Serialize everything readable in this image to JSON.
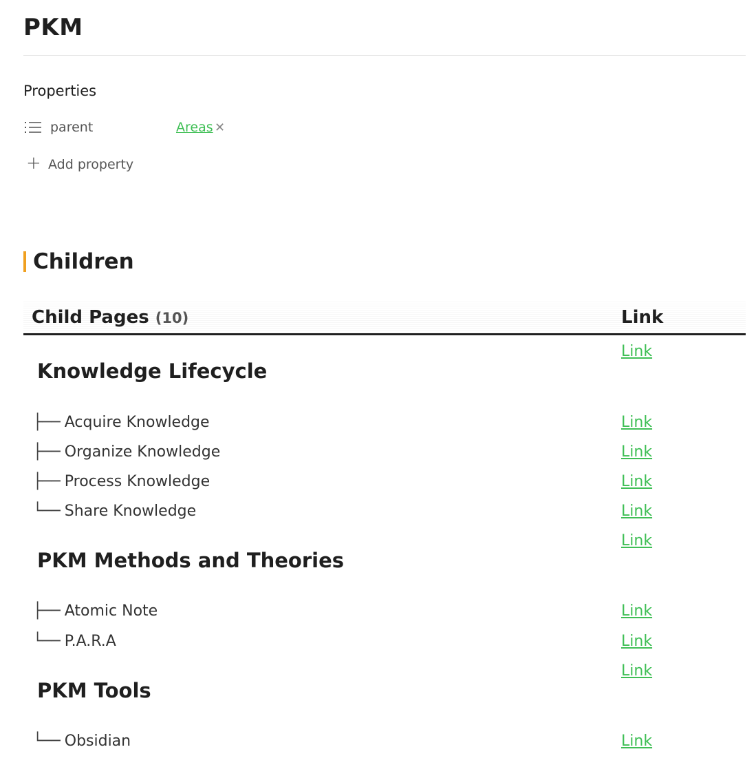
{
  "page": {
    "title": "PKM"
  },
  "properties": {
    "heading": "Properties",
    "items": [
      {
        "key": "parent",
        "value": "Areas",
        "icon": "list-icon",
        "remove_glyph": "✕"
      }
    ],
    "add_label": "Add property",
    "add_glyph": "+"
  },
  "children": {
    "heading": "Children",
    "accent_color": "#f0a020",
    "table": {
      "header_pages": "Child Pages",
      "header_count": "(10)",
      "header_link": "Link"
    },
    "groups": [
      {
        "title": "Knowledge Lifecycle",
        "link": "Link",
        "items": [
          {
            "tree": "├──",
            "label": "Acquire Knowledge",
            "link": "Link"
          },
          {
            "tree": "├──",
            "label": "Organize Knowledge",
            "link": "Link"
          },
          {
            "tree": "├──",
            "label": "Process Knowledge",
            "link": "Link"
          },
          {
            "tree": "└──",
            "label": "Share Knowledge",
            "link": "Link"
          }
        ]
      },
      {
        "title": "PKM Methods and Theories",
        "link": "Link",
        "items": [
          {
            "tree": "├──",
            "label": "Atomic Note",
            "link": "Link"
          },
          {
            "tree": "└──",
            "label": "P.A.R.A",
            "link": "Link"
          }
        ]
      },
      {
        "title": "PKM Tools",
        "link": "Link",
        "items": [
          {
            "tree": "└──",
            "label": "Obsidian",
            "link": "Link"
          }
        ]
      }
    ]
  },
  "colors": {
    "link": "#3fbf55",
    "text": "#1f1f1f"
  }
}
